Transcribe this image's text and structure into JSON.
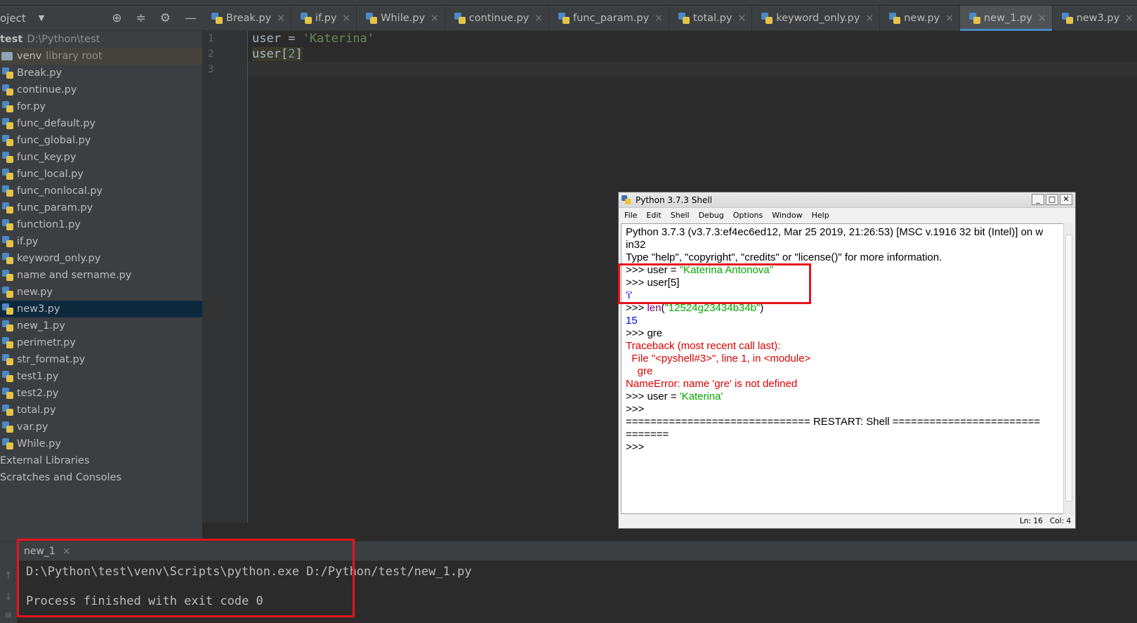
{
  "project": {
    "header_title": "oject",
    "root_name": "test",
    "root_path": "D:\\Python\\test",
    "venv_name": "venv",
    "venv_note": "library root",
    "files": [
      "Break.py",
      "continue.py",
      "for.py",
      "func_default.py",
      "func_global.py",
      "func_key.py",
      "func_local.py",
      "func_nonlocal.py",
      "func_param.py",
      "function1.py",
      "if.py",
      "keyword_only.py",
      "name and sername.py",
      "new.py",
      "new3.py",
      "new_1.py",
      "perimetr.py",
      "str_format.py",
      "test1.py",
      "test2.py",
      "total.py",
      "var.py",
      "While.py"
    ],
    "external_libraries": "External Libraries",
    "scratches": "Scratches and Consoles"
  },
  "tabs": [
    "Break.py",
    "if.py",
    "While.py",
    "continue.py",
    "func_param.py",
    "total.py",
    "keyword_only.py",
    "new.py",
    "new_1.py",
    "new3.py"
  ],
  "editor": {
    "line_numbers": [
      "1",
      "2",
      "3"
    ],
    "line1_var": "user",
    "line1_op": " = ",
    "line1_str": "'Katerina'",
    "line2_var": "user[",
    "line2_num": "2",
    "line2_end": "]"
  },
  "shell": {
    "title": "Python 3.7.3 Shell",
    "menu": [
      "File",
      "Edit",
      "Shell",
      "Debug",
      "Options",
      "Window",
      "Help"
    ],
    "lines": {
      "l1": "Python 3.7.3 (v3.7.3:ef4ec6ed12, Mar 25 2019, 21:26:53) [MSC v.1916 32 bit (Intel)] on w",
      "l2": "in32",
      "l3": "Type \"help\", \"copyright\", \"credits\" or \"license()\" for more information.",
      "prompt": ">>> ",
      "l4_code": "user = ",
      "l4_str": "\"Katerina Antonova\"",
      "l5_code": "user[5]",
      "l6_out": "'i'",
      "l7_func": "len",
      "l7_open": "(",
      "l7_str": "\"12524g23434b34b\"",
      "l7_close": ")",
      "l8_out": "15",
      "l9_code": "gre",
      "tb1": "Traceback (most recent call last):",
      "tb2": "  File \"<pyshell#3>\", line 1, in <module>",
      "tb3": "    gre",
      "tb4": "NameError: name 'gre' is not defined",
      "l10_code": "user = ",
      "l10_str": "'Katerina'",
      "l11": ">>>",
      "restart1": "============================== RESTART: Shell ========================",
      "restart2": "=======",
      "l12": ">>>"
    },
    "status_ln": "Ln: 16",
    "status_col": "Col: 4"
  },
  "run": {
    "tab_label": "new_1",
    "cmd": "D:\\Python\\test\\venv\\Scripts\\python.exe D:/Python/test/new_1.py",
    "result": "Process finished with exit code 0"
  },
  "colors": {
    "highlight_box": "#e3141c",
    "selection": "#0d293e",
    "string_green": "#6a8759"
  }
}
